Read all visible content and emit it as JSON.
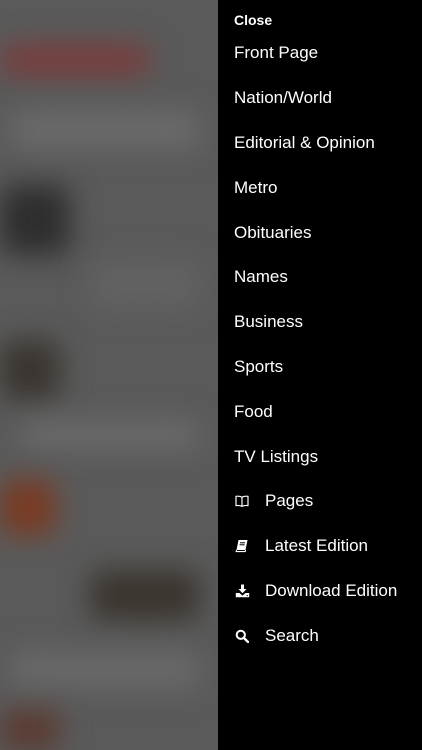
{
  "drawer": {
    "close_label": "Close",
    "items": [
      {
        "label": "Front Page"
      },
      {
        "label": "Nation/World"
      },
      {
        "label": "Editorial & Opinion"
      },
      {
        "label": "Metro"
      },
      {
        "label": "Obituaries"
      },
      {
        "label": "Names"
      },
      {
        "label": "Business"
      },
      {
        "label": "Sports"
      },
      {
        "label": "Food"
      },
      {
        "label": "TV Listings"
      },
      {
        "label": "Pages",
        "icon": "open-book-icon"
      },
      {
        "label": "Latest Edition",
        "icon": "closed-book-icon"
      },
      {
        "label": "Download Edition",
        "icon": "download-icon"
      },
      {
        "label": "Search",
        "icon": "search-icon"
      }
    ]
  },
  "colors": {
    "drawer_background": "#000000",
    "drawer_text": "#ffffff",
    "background_page": "#5a5a5a"
  }
}
